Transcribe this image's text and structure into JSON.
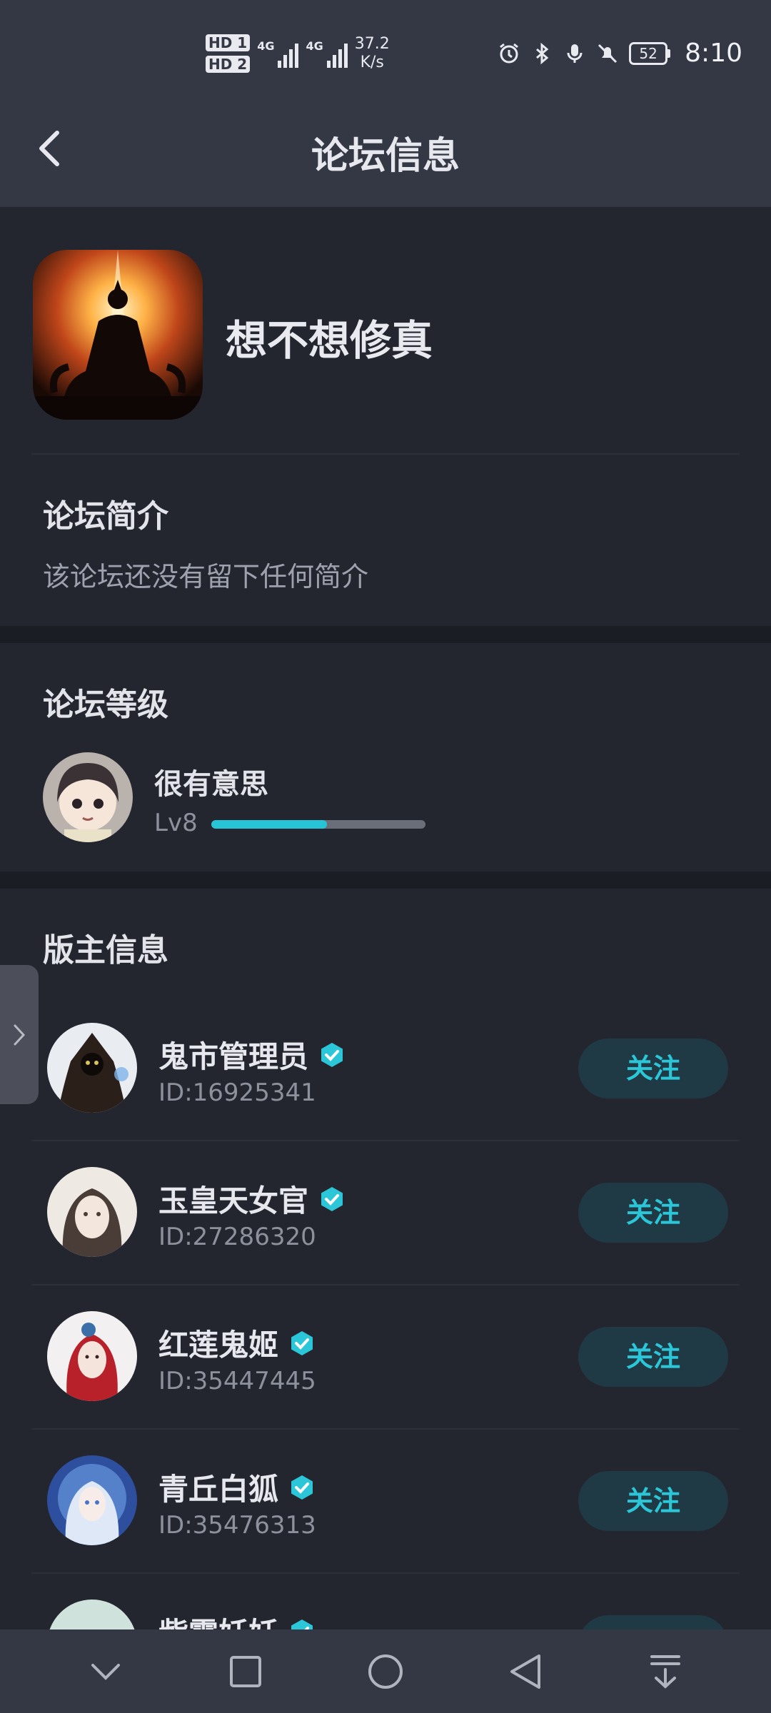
{
  "status_bar": {
    "sim1": "HD 1",
    "sim2": "HD 2",
    "network1": "4G",
    "network2": "4G",
    "speed_value": "37.2",
    "speed_unit": "K/s",
    "battery": "52",
    "time": "8:10"
  },
  "header": {
    "title": "论坛信息"
  },
  "forum": {
    "name": "想不想修真"
  },
  "intro": {
    "title": "论坛简介",
    "text": "该论坛还没有留下任何简介"
  },
  "level": {
    "title": "论坛等级",
    "name": "很有意思",
    "label": "Lv8",
    "progress": 0.54
  },
  "moderators": {
    "title": "版主信息",
    "follow_label": "关注",
    "items": [
      {
        "name": "鬼市管理员",
        "id": "ID:16925341"
      },
      {
        "name": "玉皇天女官",
        "id": "ID:27286320"
      },
      {
        "name": "红莲鬼姬",
        "id": "ID:35447445"
      },
      {
        "name": "青丘白狐",
        "id": "ID:35476313"
      },
      {
        "name": "紫霞妖妖",
        "id": ""
      }
    ]
  },
  "colors": {
    "accent": "#27c3d6",
    "background": "#23252f",
    "bar": "#343845"
  },
  "icons": [
    "back-icon",
    "alarm-icon",
    "bluetooth-icon",
    "mic-icon",
    "mute-icon",
    "battery-icon",
    "verified-icon",
    "chevron-right-icon",
    "nav-down-icon",
    "nav-square-icon",
    "nav-home-icon",
    "nav-back-icon",
    "nav-notification-icon"
  ]
}
